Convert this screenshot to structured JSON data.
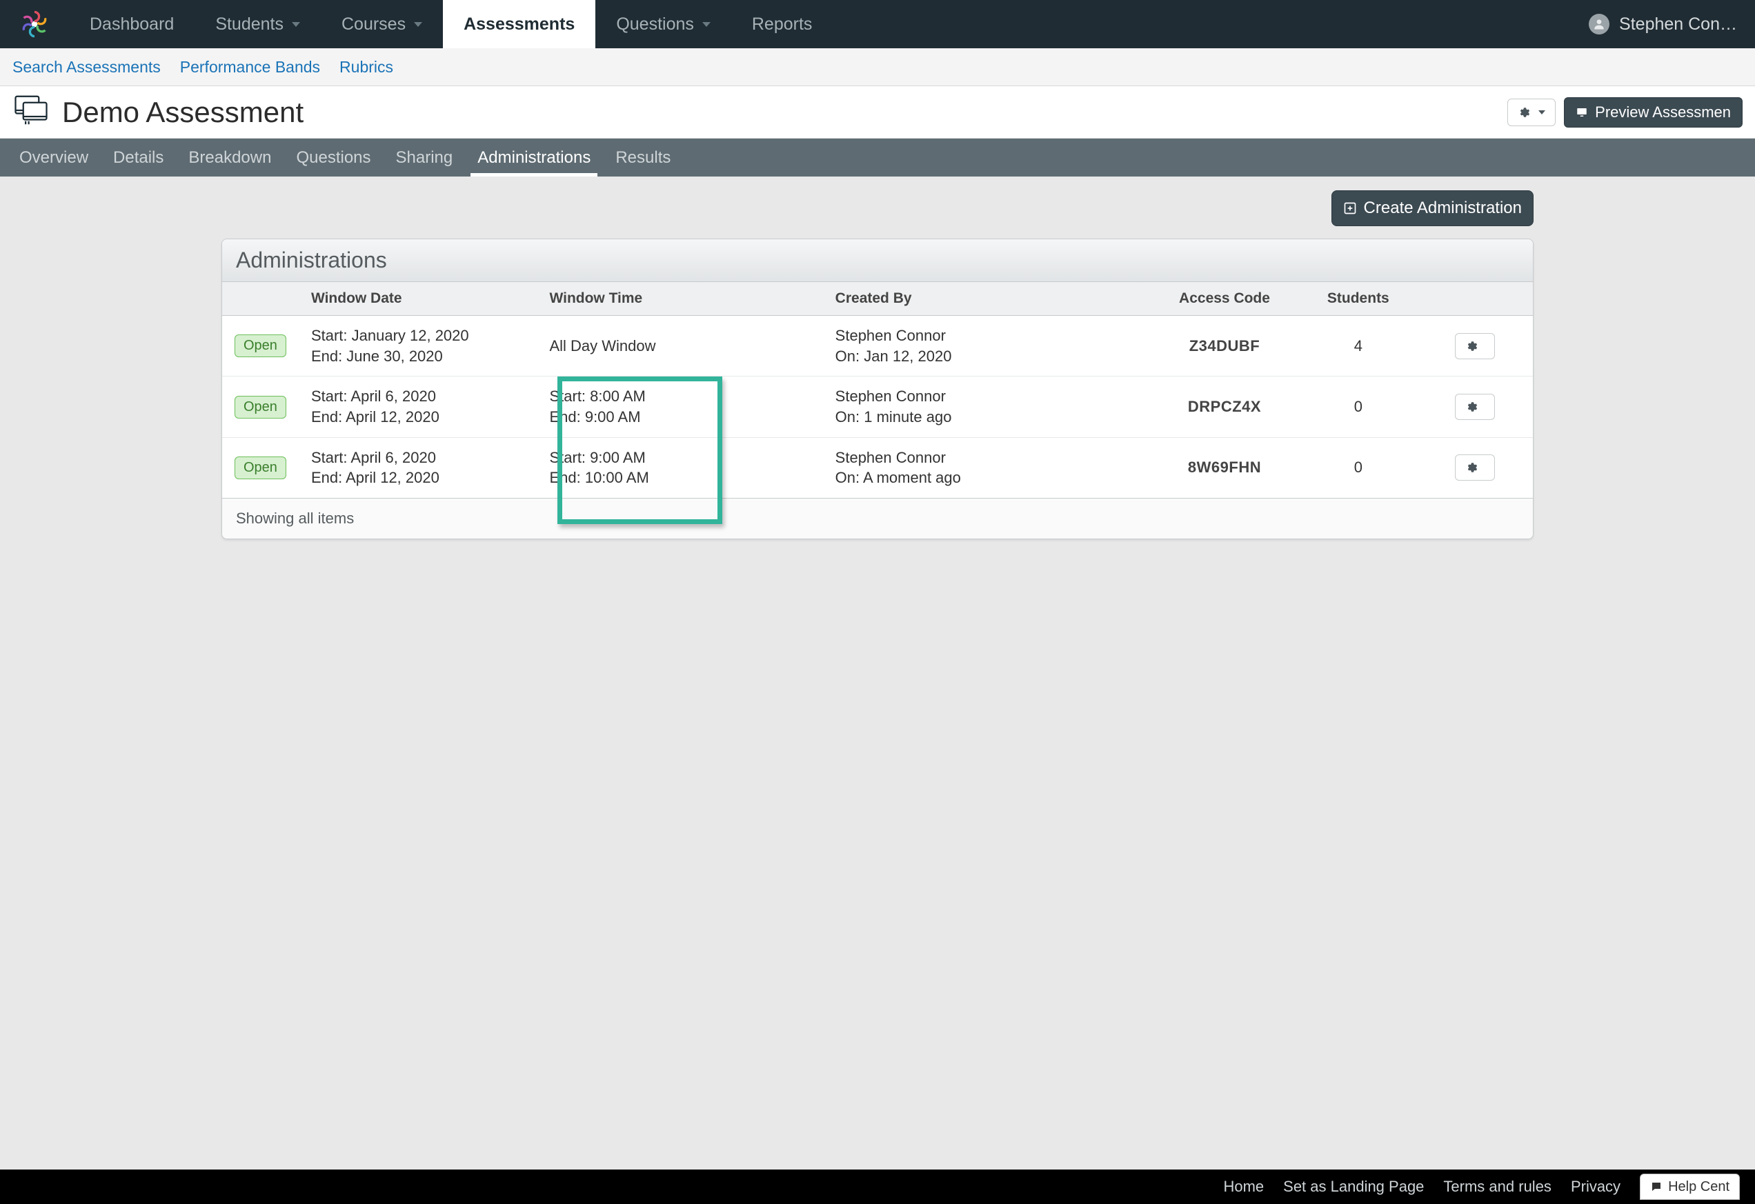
{
  "topnav": {
    "items": [
      {
        "label": "Dashboard",
        "dd": false
      },
      {
        "label": "Students",
        "dd": true
      },
      {
        "label": "Courses",
        "dd": true
      },
      {
        "label": "Assessments",
        "dd": false,
        "active": true
      },
      {
        "label": "Questions",
        "dd": true
      },
      {
        "label": "Reports",
        "dd": false
      }
    ],
    "user": "Stephen Con…"
  },
  "subnav": {
    "items": [
      "Search Assessments",
      "Performance Bands",
      "Rubrics"
    ]
  },
  "page": {
    "title": "Demo Assessment",
    "preview_label": "Preview Assessmen"
  },
  "tabs": {
    "items": [
      "Overview",
      "Details",
      "Breakdown",
      "Questions",
      "Sharing",
      "Administrations",
      "Results"
    ],
    "active": 5
  },
  "create_label": "Create Administration",
  "panel": {
    "title": "Administrations",
    "footer": "Showing all items"
  },
  "columns": {
    "date": "Window Date",
    "time": "Window Time",
    "by": "Created By",
    "code": "Access Code",
    "students": "Students"
  },
  "rows": [
    {
      "status": "Open",
      "date_start": "Start: January 12, 2020",
      "date_end": "End: June 30, 2020",
      "time_line1": "All Day Window",
      "time_line2": "",
      "by_name": "Stephen Connor",
      "by_when": "On: Jan 12, 2020",
      "code": "Z34DUBF",
      "students": "4"
    },
    {
      "status": "Open",
      "date_start": "Start: April 6, 2020",
      "date_end": "End: April 12, 2020",
      "time_line1": "Start: 8:00 AM",
      "time_line2": "End: 9:00 AM",
      "by_name": "Stephen Connor",
      "by_when": "On: 1 minute ago",
      "code": "DRPCZ4X",
      "students": "0"
    },
    {
      "status": "Open",
      "date_start": "Start: April 6, 2020",
      "date_end": "End: April 12, 2020",
      "time_line1": "Start: 9:00 AM",
      "time_line2": "End: 10:00 AM",
      "by_name": "Stephen Connor",
      "by_when": "On: A moment ago",
      "code": "8W69FHN",
      "students": "0"
    }
  ],
  "footer": {
    "links": [
      "Home",
      "Set as Landing Page",
      "Terms and rules",
      "Privacy"
    ],
    "help": "Help Cent"
  }
}
